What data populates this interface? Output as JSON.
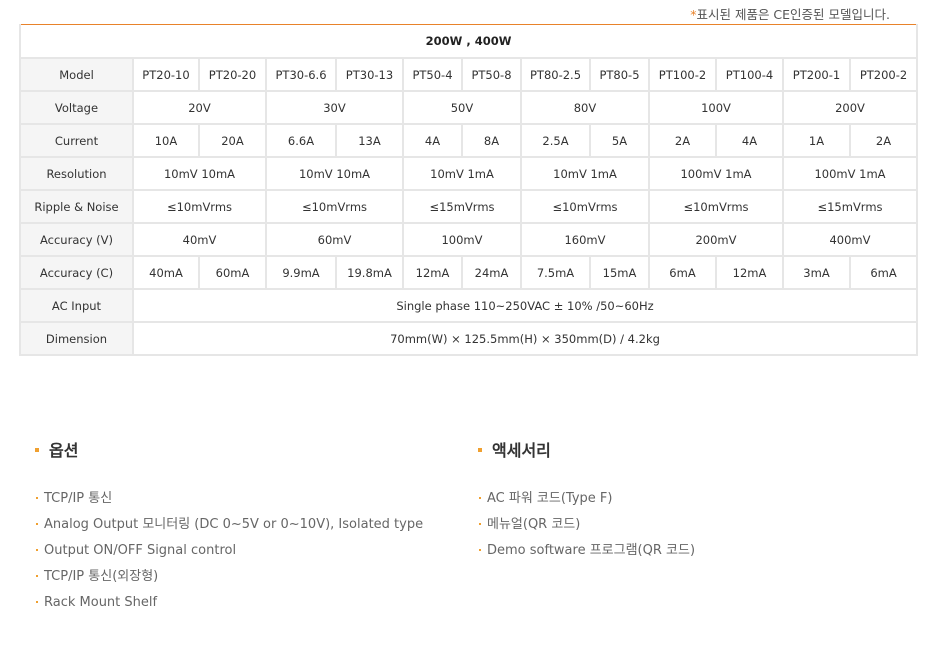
{
  "note": {
    "asterisk": "*",
    "text": "표시된 제품은 CE인증된 모델입니다."
  },
  "accent_color": "#e8822a",
  "table": {
    "title": "200W , 400W",
    "rows": [
      {
        "label": "Model",
        "cells": [
          {
            "text": "PT20-10",
            "span": 1
          },
          {
            "text": "PT20-20",
            "span": 1
          },
          {
            "text": "PT30-6.6",
            "span": 1
          },
          {
            "text": "PT30-13",
            "span": 1
          },
          {
            "text": "PT50-4",
            "span": 1
          },
          {
            "text": "PT50-8",
            "span": 1
          },
          {
            "text": "PT80-2.5",
            "span": 1
          },
          {
            "text": "PT80-5",
            "span": 1
          },
          {
            "text": "PT100-2",
            "span": 1
          },
          {
            "text": "PT100-4",
            "span": 1
          },
          {
            "text": "PT200-1",
            "span": 1
          },
          {
            "text": "PT200-2",
            "span": 1
          }
        ]
      },
      {
        "label": "Voltage",
        "cells": [
          {
            "text": "20V",
            "span": 2
          },
          {
            "text": "30V",
            "span": 2
          },
          {
            "text": "50V",
            "span": 2
          },
          {
            "text": "80V",
            "span": 2
          },
          {
            "text": "100V",
            "span": 2
          },
          {
            "text": "200V",
            "span": 2
          }
        ]
      },
      {
        "label": "Current",
        "cells": [
          {
            "text": "10A",
            "span": 1
          },
          {
            "text": "20A",
            "span": 1
          },
          {
            "text": "6.6A",
            "span": 1
          },
          {
            "text": "13A",
            "span": 1
          },
          {
            "text": "4A",
            "span": 1
          },
          {
            "text": "8A",
            "span": 1
          },
          {
            "text": "2.5A",
            "span": 1
          },
          {
            "text": "5A",
            "span": 1
          },
          {
            "text": "2A",
            "span": 1
          },
          {
            "text": "4A",
            "span": 1
          },
          {
            "text": "1A",
            "span": 1
          },
          {
            "text": "2A",
            "span": 1
          }
        ]
      },
      {
        "label": "Resolution",
        "cells": [
          {
            "text": "10mV 10mA",
            "span": 2
          },
          {
            "text": "10mV 10mA",
            "span": 2
          },
          {
            "text": "10mV 1mA",
            "span": 2
          },
          {
            "text": "10mV 1mA",
            "span": 2
          },
          {
            "text": "100mV 1mA",
            "span": 2
          },
          {
            "text": "100mV 1mA",
            "span": 2
          }
        ]
      },
      {
        "label": "Ripple & Noise",
        "cells": [
          {
            "text": "≤10mVrms",
            "span": 2
          },
          {
            "text": "≤10mVrms",
            "span": 2
          },
          {
            "text": "≤15mVrms",
            "span": 2
          },
          {
            "text": "≤10mVrms",
            "span": 2
          },
          {
            "text": "≤10mVrms",
            "span": 2
          },
          {
            "text": "≤15mVrms",
            "span": 2
          }
        ]
      },
      {
        "label": "Accuracy (V)",
        "cells": [
          {
            "text": "40mV",
            "span": 2
          },
          {
            "text": "60mV",
            "span": 2
          },
          {
            "text": "100mV",
            "span": 2
          },
          {
            "text": "160mV",
            "span": 2
          },
          {
            "text": "200mV",
            "span": 2
          },
          {
            "text": "400mV",
            "span": 2
          }
        ]
      },
      {
        "label": "Accuracy (C)",
        "cells": [
          {
            "text": "40mA",
            "span": 1
          },
          {
            "text": "60mA",
            "span": 1
          },
          {
            "text": "9.9mA",
            "span": 1
          },
          {
            "text": "19.8mA",
            "span": 1
          },
          {
            "text": "12mA",
            "span": 1
          },
          {
            "text": "24mA",
            "span": 1
          },
          {
            "text": "7.5mA",
            "span": 1
          },
          {
            "text": "15mA",
            "span": 1
          },
          {
            "text": "6mA",
            "span": 1
          },
          {
            "text": "12mA",
            "span": 1
          },
          {
            "text": "3mA",
            "span": 1
          },
          {
            "text": "6mA",
            "span": 1
          }
        ]
      },
      {
        "label": "AC Input",
        "cells": [
          {
            "text": "Single phase 110~250VAC ± 10% /50~60Hz",
            "span": 12
          }
        ]
      },
      {
        "label": "Dimension",
        "cells": [
          {
            "text": "70mm(W) × 125.5mm(H) × 350mm(D) / 4.2kg",
            "span": 12
          }
        ]
      }
    ]
  },
  "options": {
    "title": "옵션",
    "items": [
      "TCP/IP 통신",
      "Analog Output 모니터링 (DC 0~5V or 0~10V), Isolated type",
      "Output ON/OFF Signal control",
      "TCP/IP 통신(외장형)",
      "Rack Mount Shelf"
    ]
  },
  "accessories": {
    "title": "액세서리",
    "items": [
      "AC 파워 코드(Type F)",
      "메뉴얼(QR 코드)",
      "Demo software 프로그램(QR 코드)"
    ]
  }
}
